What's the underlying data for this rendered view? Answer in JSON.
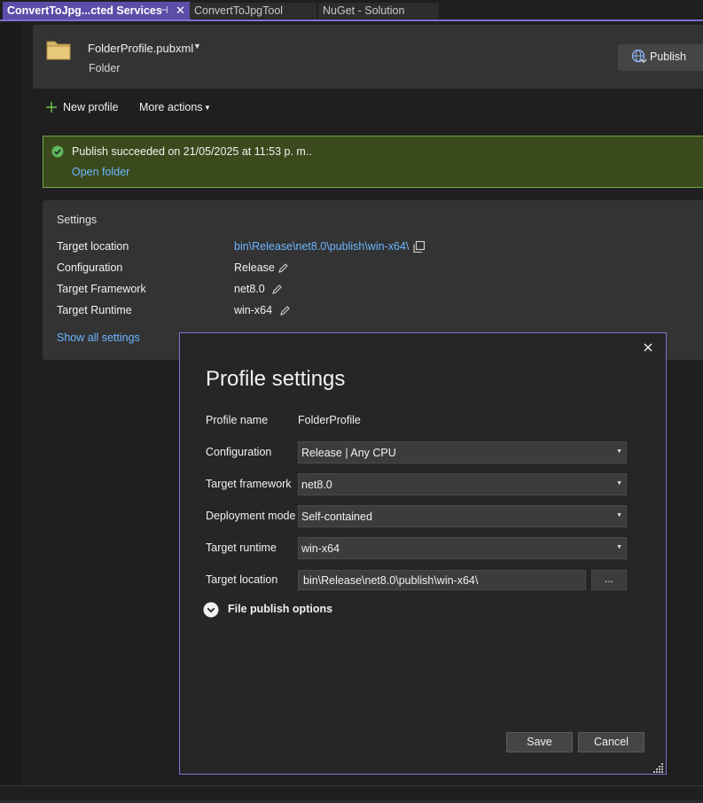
{
  "tabs": [
    {
      "label": "ConvertToJpg...cted Services",
      "pin_glyph": "⊣",
      "close_glyph": "✕"
    },
    {
      "label": "ConvertToJpgTool"
    },
    {
      "label": "NuGet - Solution"
    }
  ],
  "header": {
    "profile_name": "FolderProfile.pubxml",
    "profile_type": "Folder",
    "publish_label": "Publish"
  },
  "actions": {
    "new_profile": "New profile",
    "more_actions": "More actions"
  },
  "banner": {
    "message": "Publish succeeded on 21/05/2025 at 11:53 p. m..",
    "open_folder": "Open folder"
  },
  "settings": {
    "heading": "Settings",
    "rows": [
      {
        "label": "Target location",
        "value": "bin\\Release\\net8.0\\publish\\win-x64\\"
      },
      {
        "label": "Configuration",
        "value": "Release"
      },
      {
        "label": "Target Framework",
        "value": "net8.0"
      },
      {
        "label": "Target Runtime",
        "value": "win-x64"
      }
    ],
    "show_all": "Show all settings"
  },
  "dialog": {
    "title": "Profile settings",
    "profile_name_label": "Profile name",
    "profile_name_value": "FolderProfile",
    "configuration_label": "Configuration",
    "configuration_value": "Release | Any CPU",
    "framework_label": "Target framework",
    "framework_value": "net8.0",
    "deployment_label": "Deployment mode",
    "deployment_value": "Self-contained",
    "runtime_label": "Target runtime",
    "runtime_value": "win-x64",
    "location_label": "Target location",
    "location_value": "bin\\Release\\net8.0\\publish\\win-x64\\",
    "browse_label": "...",
    "file_options_label": "File publish options",
    "save_label": "Save",
    "cancel_label": "Cancel"
  },
  "colors": {
    "accent": "#7b73d1",
    "link": "#6cb6ff",
    "success_bg": "#3b4a1d",
    "success_border": "#6fa84a",
    "active_tab": "#5d4da8"
  },
  "icons": {
    "folder": "folder-icon",
    "publish": "globe-publish-icon",
    "new_profile": "plus-icon",
    "success": "check-circle-icon",
    "copy": "copy-icon",
    "edit": "pencil-icon",
    "close": "close-icon",
    "expander": "chevron-down-circle-icon",
    "dropdown": "caret-down-icon"
  }
}
